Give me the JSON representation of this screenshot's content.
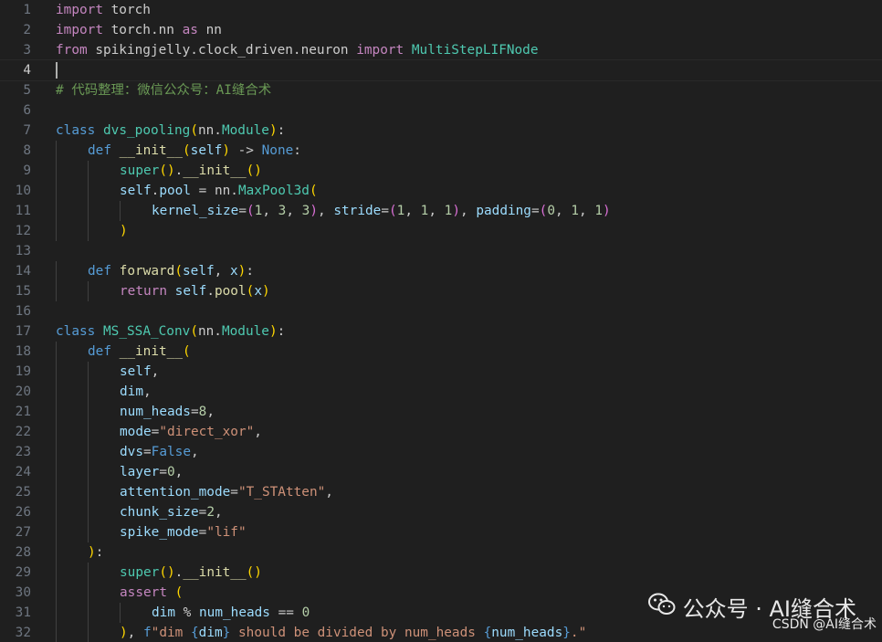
{
  "editor": {
    "lines": [
      {
        "n": "1",
        "indent": 0,
        "tokens": [
          [
            "ctl",
            "import"
          ],
          [
            "plain",
            " torch"
          ]
        ]
      },
      {
        "n": "2",
        "indent": 0,
        "tokens": [
          [
            "ctl",
            "import"
          ],
          [
            "plain",
            " torch.nn "
          ],
          [
            "ctl",
            "as"
          ],
          [
            "plain",
            " nn"
          ]
        ]
      },
      {
        "n": "3",
        "indent": 0,
        "tokens": [
          [
            "ctl",
            "from"
          ],
          [
            "plain",
            " spikingjelly.clock_driven.neuron "
          ],
          [
            "ctl",
            "import"
          ],
          [
            "plain",
            " "
          ],
          [
            "cls",
            "MultiStepLIFNode"
          ]
        ]
      },
      {
        "n": "4",
        "indent": 0,
        "current": true,
        "tokens": []
      },
      {
        "n": "5",
        "indent": 0,
        "tokens": [
          [
            "cmt",
            "# 代码整理：微信公众号：AI缝合术"
          ]
        ]
      },
      {
        "n": "6",
        "indent": 0,
        "tokens": []
      },
      {
        "n": "7",
        "indent": 0,
        "tokens": [
          [
            "kw",
            "class"
          ],
          [
            "plain",
            " "
          ],
          [
            "cls",
            "dvs_pooling"
          ],
          [
            "p1",
            "("
          ],
          [
            "plain",
            "nn."
          ],
          [
            "cls",
            "Module"
          ],
          [
            "p1",
            ")"
          ],
          [
            "plain",
            ":"
          ]
        ]
      },
      {
        "n": "8",
        "indent": 1,
        "tokens": [
          [
            "kw",
            "def"
          ],
          [
            "plain",
            " "
          ],
          [
            "fn",
            "__init__"
          ],
          [
            "p1",
            "("
          ],
          [
            "var",
            "self"
          ],
          [
            "p1",
            ")"
          ],
          [
            "plain",
            " -> "
          ],
          [
            "kw",
            "None"
          ],
          [
            "plain",
            ":"
          ]
        ]
      },
      {
        "n": "9",
        "indent": 2,
        "tokens": [
          [
            "cls",
            "super"
          ],
          [
            "p1",
            "()"
          ],
          [
            "plain",
            "."
          ],
          [
            "fn",
            "__init__"
          ],
          [
            "p1",
            "()"
          ]
        ]
      },
      {
        "n": "10",
        "indent": 2,
        "tokens": [
          [
            "var",
            "self"
          ],
          [
            "plain",
            "."
          ],
          [
            "var",
            "pool"
          ],
          [
            "plain",
            " = nn."
          ],
          [
            "cls",
            "MaxPool3d"
          ],
          [
            "p1",
            "("
          ]
        ]
      },
      {
        "n": "11",
        "indent": 3,
        "tokens": [
          [
            "var",
            "kernel_size"
          ],
          [
            "plain",
            "="
          ],
          [
            "p2",
            "("
          ],
          [
            "num",
            "1"
          ],
          [
            "plain",
            ", "
          ],
          [
            "num",
            "3"
          ],
          [
            "plain",
            ", "
          ],
          [
            "num",
            "3"
          ],
          [
            "p2",
            ")"
          ],
          [
            "plain",
            ", "
          ],
          [
            "var",
            "stride"
          ],
          [
            "plain",
            "="
          ],
          [
            "p2",
            "("
          ],
          [
            "num",
            "1"
          ],
          [
            "plain",
            ", "
          ],
          [
            "num",
            "1"
          ],
          [
            "plain",
            ", "
          ],
          [
            "num",
            "1"
          ],
          [
            "p2",
            ")"
          ],
          [
            "plain",
            ", "
          ],
          [
            "var",
            "padding"
          ],
          [
            "plain",
            "="
          ],
          [
            "p2",
            "("
          ],
          [
            "num",
            "0"
          ],
          [
            "plain",
            ", "
          ],
          [
            "num",
            "1"
          ],
          [
            "plain",
            ", "
          ],
          [
            "num",
            "1"
          ],
          [
            "p2",
            ")"
          ]
        ]
      },
      {
        "n": "12",
        "indent": 2,
        "tokens": [
          [
            "p1",
            ")"
          ]
        ]
      },
      {
        "n": "13",
        "indent": 0,
        "tokens": []
      },
      {
        "n": "14",
        "indent": 1,
        "tokens": [
          [
            "kw",
            "def"
          ],
          [
            "plain",
            " "
          ],
          [
            "fn",
            "forward"
          ],
          [
            "p1",
            "("
          ],
          [
            "var",
            "self"
          ],
          [
            "plain",
            ", "
          ],
          [
            "var",
            "x"
          ],
          [
            "p1",
            ")"
          ],
          [
            "plain",
            ":"
          ]
        ]
      },
      {
        "n": "15",
        "indent": 2,
        "tokens": [
          [
            "ctl",
            "return"
          ],
          [
            "plain",
            " "
          ],
          [
            "var",
            "self"
          ],
          [
            "plain",
            "."
          ],
          [
            "fn",
            "pool"
          ],
          [
            "p1",
            "("
          ],
          [
            "var",
            "x"
          ],
          [
            "p1",
            ")"
          ]
        ]
      },
      {
        "n": "16",
        "indent": 0,
        "tokens": []
      },
      {
        "n": "17",
        "indent": 0,
        "tokens": [
          [
            "kw",
            "class"
          ],
          [
            "plain",
            " "
          ],
          [
            "cls",
            "MS_SSA_Conv"
          ],
          [
            "p1",
            "("
          ],
          [
            "plain",
            "nn."
          ],
          [
            "cls",
            "Module"
          ],
          [
            "p1",
            ")"
          ],
          [
            "plain",
            ":"
          ]
        ]
      },
      {
        "n": "18",
        "indent": 1,
        "tokens": [
          [
            "kw",
            "def"
          ],
          [
            "plain",
            " "
          ],
          [
            "fn",
            "__init__"
          ],
          [
            "p1",
            "("
          ]
        ]
      },
      {
        "n": "19",
        "indent": 2,
        "tokens": [
          [
            "var",
            "self"
          ],
          [
            "plain",
            ","
          ]
        ]
      },
      {
        "n": "20",
        "indent": 2,
        "tokens": [
          [
            "var",
            "dim"
          ],
          [
            "plain",
            ","
          ]
        ]
      },
      {
        "n": "21",
        "indent": 2,
        "tokens": [
          [
            "var",
            "num_heads"
          ],
          [
            "plain",
            "="
          ],
          [
            "num",
            "8"
          ],
          [
            "plain",
            ","
          ]
        ]
      },
      {
        "n": "22",
        "indent": 2,
        "tokens": [
          [
            "var",
            "mode"
          ],
          [
            "plain",
            "="
          ],
          [
            "str",
            "\"direct_xor\""
          ],
          [
            "plain",
            ","
          ]
        ]
      },
      {
        "n": "23",
        "indent": 2,
        "tokens": [
          [
            "var",
            "dvs"
          ],
          [
            "plain",
            "="
          ],
          [
            "kw",
            "False"
          ],
          [
            "plain",
            ","
          ]
        ]
      },
      {
        "n": "24",
        "indent": 2,
        "tokens": [
          [
            "var",
            "layer"
          ],
          [
            "plain",
            "="
          ],
          [
            "num",
            "0"
          ],
          [
            "plain",
            ","
          ]
        ]
      },
      {
        "n": "25",
        "indent": 2,
        "tokens": [
          [
            "var",
            "attention_mode"
          ],
          [
            "plain",
            "="
          ],
          [
            "str",
            "\"T_STAtten\""
          ],
          [
            "plain",
            ","
          ]
        ]
      },
      {
        "n": "26",
        "indent": 2,
        "tokens": [
          [
            "var",
            "chunk_size"
          ],
          [
            "plain",
            "="
          ],
          [
            "num",
            "2"
          ],
          [
            "plain",
            ","
          ]
        ]
      },
      {
        "n": "27",
        "indent": 2,
        "tokens": [
          [
            "var",
            "spike_mode"
          ],
          [
            "plain",
            "="
          ],
          [
            "str",
            "\"lif\""
          ]
        ]
      },
      {
        "n": "28",
        "indent": 1,
        "tokens": [
          [
            "p1",
            ")"
          ],
          [
            "plain",
            ":"
          ]
        ]
      },
      {
        "n": "29",
        "indent": 2,
        "tokens": [
          [
            "cls",
            "super"
          ],
          [
            "p1",
            "()"
          ],
          [
            "plain",
            "."
          ],
          [
            "fn",
            "__init__"
          ],
          [
            "p1",
            "()"
          ]
        ]
      },
      {
        "n": "30",
        "indent": 2,
        "tokens": [
          [
            "ctl",
            "assert"
          ],
          [
            "plain",
            " "
          ],
          [
            "p1",
            "("
          ]
        ]
      },
      {
        "n": "31",
        "indent": 3,
        "tokens": [
          [
            "var",
            "dim"
          ],
          [
            "plain",
            " % "
          ],
          [
            "var",
            "num_heads"
          ],
          [
            "plain",
            " == "
          ],
          [
            "num",
            "0"
          ]
        ]
      },
      {
        "n": "32",
        "indent": 2,
        "tokens": [
          [
            "p1",
            ")"
          ],
          [
            "plain",
            ", "
          ],
          [
            "kw",
            "f"
          ],
          [
            "str",
            "\"dim "
          ],
          [
            "kw",
            "{"
          ],
          [
            "var",
            "dim"
          ],
          [
            "kw",
            "}"
          ],
          [
            "str",
            " should be divided by num_heads "
          ],
          [
            "kw",
            "{"
          ],
          [
            "var",
            "num_heads"
          ],
          [
            "kw",
            "}"
          ],
          [
            "str",
            ".\""
          ]
        ]
      }
    ]
  },
  "watermark": {
    "icon": "wechat-icon",
    "text": "公众号 · AI缝合术",
    "source": "CSDN @AI缝合术"
  },
  "colors": {
    "background": "#1f1f1f",
    "keyword": "#569cd6",
    "control": "#c586c0",
    "function": "#dcdcaa",
    "class": "#4ec9b0",
    "variable": "#9cdcfe",
    "string": "#ce9178",
    "number": "#b5cea8",
    "comment": "#6a9955"
  }
}
